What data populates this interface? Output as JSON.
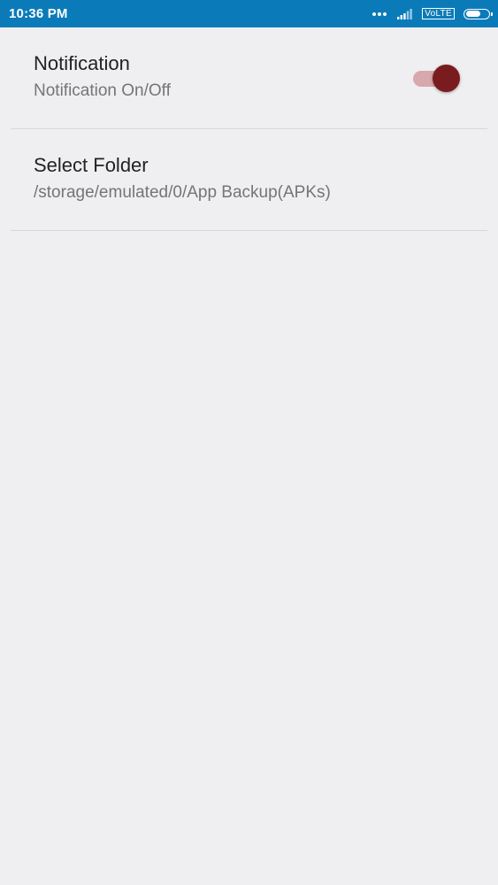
{
  "status_bar": {
    "time": "10:36 PM",
    "network_label": "VoLTE",
    "battery_level": 0.7,
    "icons": [
      "more-dots-icon",
      "signal-icon",
      "volte-icon",
      "battery-icon"
    ]
  },
  "settings": [
    {
      "title": "Notification",
      "summary": "Notification On/Off",
      "toggle": {
        "checked": true
      }
    },
    {
      "title": "Select Folder",
      "summary": "/storage/emulated/0/App Backup(APKs)"
    }
  ],
  "colors": {
    "status_bar_bg": "#0a7bb8",
    "background": "#efeef0",
    "toggle_thumb": "#7a1c1f",
    "toggle_track": "#d7a8ac",
    "divider": "#d8d8d8"
  }
}
